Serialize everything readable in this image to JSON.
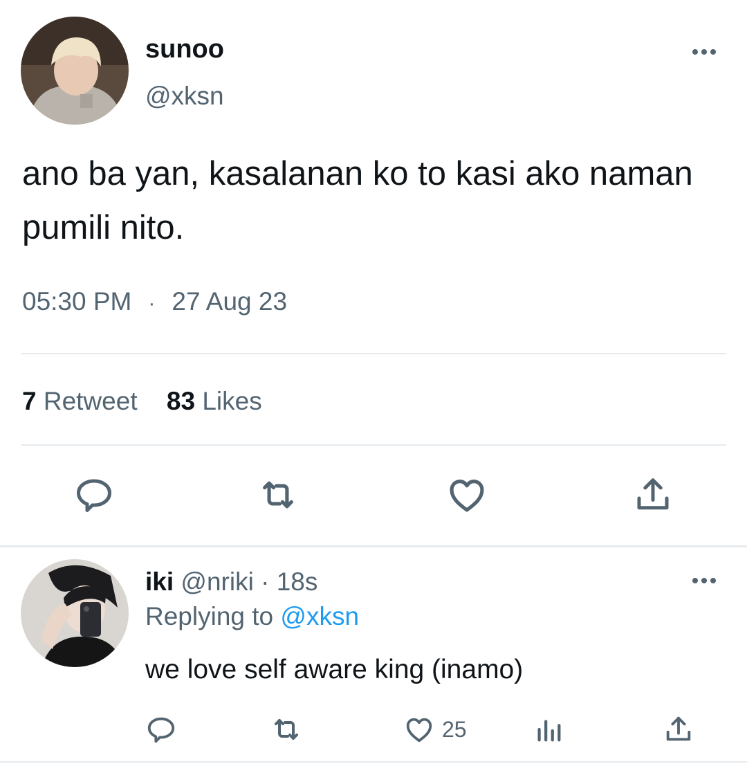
{
  "tweet": {
    "author_name": "sunoo",
    "author_handle": "@xksn",
    "text": "ano ba yan, kasalanan ko to kasi ako naman pumili nito.",
    "time": "05:30 PM",
    "separator": "·",
    "date": "27 Aug 23",
    "retweet_count": "7",
    "retweet_label": "Retweet",
    "like_count": "83",
    "like_label": "Likes"
  },
  "reply": {
    "author_name": "iki",
    "author_handle": "@nriki",
    "separator": "·",
    "time_ago": "18s",
    "replying_prefix": "Replying to",
    "replying_to": "@xksn",
    "text": "we love self aware king (inamo)",
    "like_count": "25"
  },
  "icons": {
    "more": "more-horizontal-icon",
    "reply": "reply-bubble-icon",
    "retweet": "retweet-icon",
    "like": "heart-icon",
    "share": "share-icon",
    "analytics": "analytics-icon"
  },
  "colors": {
    "text": "#0f1419",
    "secondary": "#536471",
    "link": "#1d9bf0",
    "divider": "#e7ebee"
  }
}
